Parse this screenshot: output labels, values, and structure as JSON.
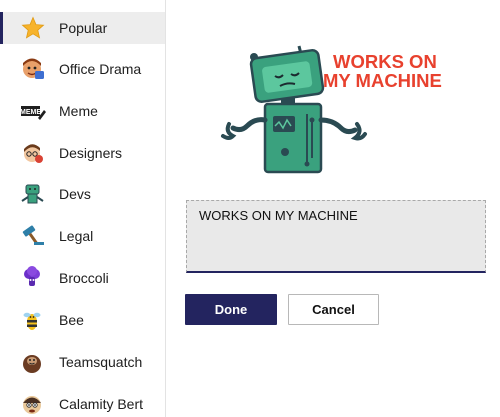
{
  "sidebar": {
    "items": [
      {
        "label": "Popular",
        "icon": "star-icon",
        "selected": true
      },
      {
        "label": "Office Drama",
        "icon": "office-drama-icon",
        "selected": false
      },
      {
        "label": "Meme",
        "icon": "meme-icon",
        "selected": false
      },
      {
        "label": "Designers",
        "icon": "designers-icon",
        "selected": false
      },
      {
        "label": "Devs",
        "icon": "devs-icon",
        "selected": false
      },
      {
        "label": "Legal",
        "icon": "legal-icon",
        "selected": false
      },
      {
        "label": "Broccoli",
        "icon": "broccoli-icon",
        "selected": false
      },
      {
        "label": "Bee",
        "icon": "bee-icon",
        "selected": false
      },
      {
        "label": "Teamsquatch",
        "icon": "teamsquatch-icon",
        "selected": false
      },
      {
        "label": "Calamity Bert",
        "icon": "calamity-bert-icon",
        "selected": false
      }
    ]
  },
  "sticker": {
    "line1": "WORKS ON",
    "line2": "MY MACHINE",
    "icon": "robot-sticker"
  },
  "editor": {
    "value": "WORKS ON MY MACHINE"
  },
  "actions": {
    "done_label": "Done",
    "cancel_label": "Cancel"
  },
  "colors": {
    "accent": "#23245f",
    "sticker_text": "#e8412e",
    "robot_green": "#3aa17e",
    "selected_bg": "#ededed"
  }
}
